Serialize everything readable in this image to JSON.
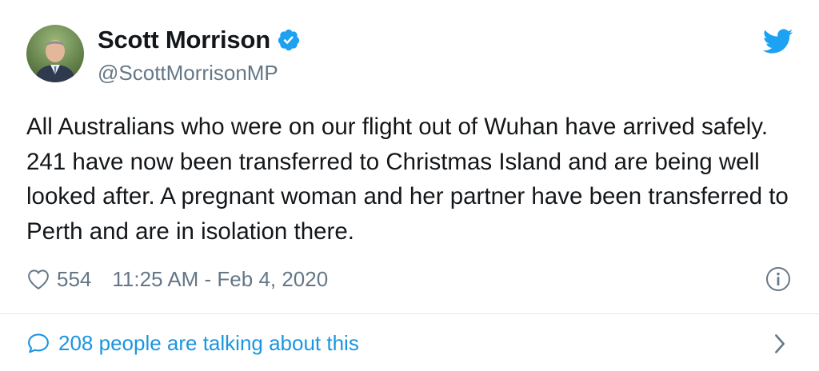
{
  "author": {
    "display_name": "Scott Morrison",
    "handle": "@ScottMorrisonMP",
    "verified": true
  },
  "tweet": {
    "text": "All Australians who were on our flight out of Wuhan have arrived safely. 241 have now been transferred to Christmas Island and are being well looked after. A pregnant woman and her partner have been transferred to Perth and are in isolation there."
  },
  "meta": {
    "like_count": "554",
    "timestamp": "11:25 AM - Feb 4, 2020"
  },
  "footer": {
    "talking_text": "208 people are talking about this"
  },
  "colors": {
    "accent": "#1b95e0",
    "twitter_blue": "#1da1f2",
    "secondary_text": "#657786",
    "divider": "#e1e8ed"
  },
  "icons": {
    "verified": "verified-badge-icon",
    "bird": "twitter-bird-icon",
    "like": "heart-icon",
    "info": "info-icon",
    "comment": "comment-icon",
    "more": "chevron-right-icon"
  }
}
